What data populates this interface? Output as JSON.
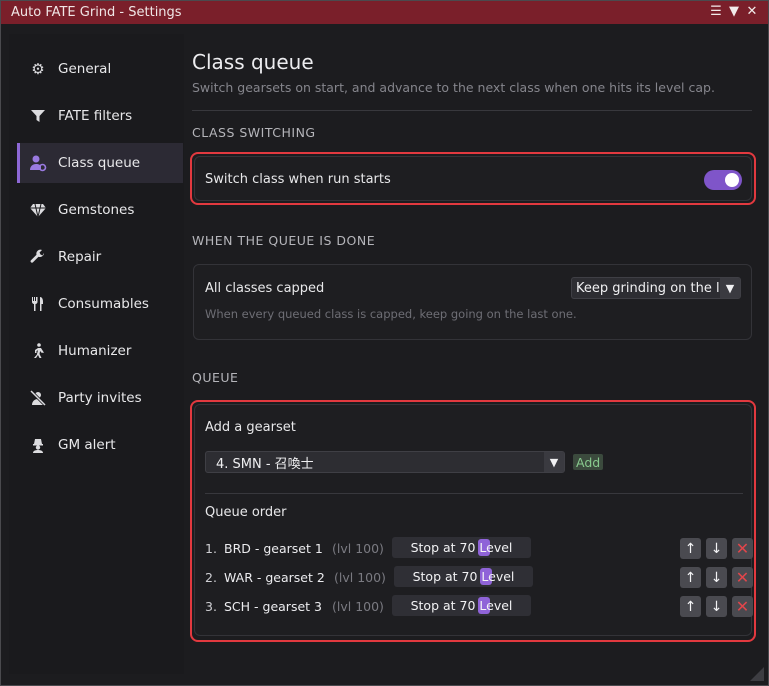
{
  "window": {
    "title": "Auto FATE Grind - Settings",
    "icons": [
      "menu-icon",
      "collapse-icon",
      "close-icon"
    ]
  },
  "sidebar": {
    "items": [
      {
        "label": "General",
        "icon": "gear-icon"
      },
      {
        "label": "FATE filters",
        "icon": "filter-icon"
      },
      {
        "label": "Class queue",
        "icon": "user-queue-icon",
        "active": true
      },
      {
        "label": "Gemstones",
        "icon": "gem-icon"
      },
      {
        "label": "Repair",
        "icon": "wrench-icon"
      },
      {
        "label": "Consumables",
        "icon": "fork-knife-icon"
      },
      {
        "label": "Humanizer",
        "icon": "walking-person-icon"
      },
      {
        "label": "Party invites",
        "icon": "no-user-icon"
      },
      {
        "label": "GM alert",
        "icon": "gm-icon"
      }
    ]
  },
  "main": {
    "title": "Class queue",
    "subtitle": "Switch gearsets on start, and advance to the next class when one hits its level cap.",
    "class_switching": {
      "heading": "CLASS SWITCHING",
      "switch_label": "Switch class when run starts",
      "switch_on": true
    },
    "queue_done": {
      "heading": "WHEN THE QUEUE IS DONE",
      "label": "All classes capped",
      "select_value": "Keep grinding on the la",
      "hint": "When every queued class is capped, keep going on the last one."
    },
    "queue": {
      "heading": "QUEUE",
      "add_label": "Add a gearset",
      "gearset_value": "4. SMN - 召喚士",
      "add_button": "Add",
      "order_label": "Queue order",
      "rows": [
        {
          "num": "1.",
          "name": "BRD - gearset 1",
          "level": "(lvl 100)",
          "slider": "Stop at 70 Level"
        },
        {
          "num": "2.",
          "name": "WAR - gearset 2",
          "level": "(lvl 100)",
          "slider": "Stop at 70 Level"
        },
        {
          "num": "3.",
          "name": "SCH - gearset 3",
          "level": "(lvl 100)",
          "slider": "Stop at 70 Level"
        }
      ]
    }
  },
  "colors": {
    "titlebar": "#7a1f2a",
    "accent": "#8d68d6",
    "highlight": "#e2393f",
    "add_text": "#88c98e"
  }
}
